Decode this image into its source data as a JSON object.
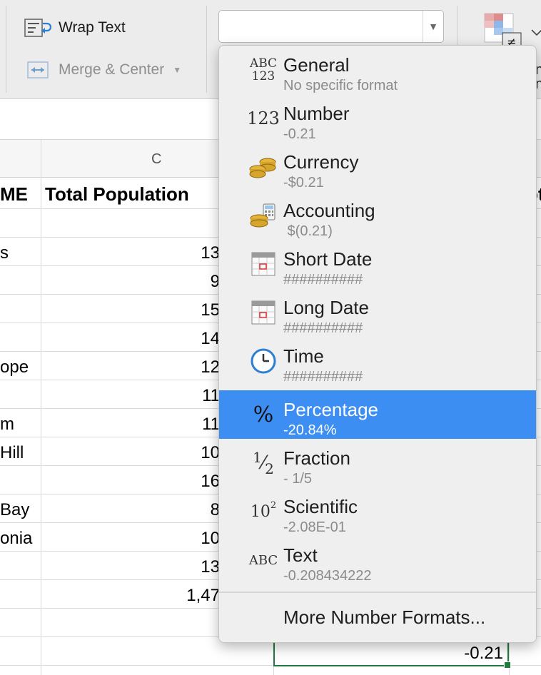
{
  "ribbon": {
    "wrap_text_label": "Wrap Text",
    "merge_center_label": "Merge & Center",
    "number_format_value": "",
    "cut_off_label": "na\nn"
  },
  "columns": {
    "c_label": "C"
  },
  "sheet": {
    "header_a": "ME",
    "header_c": "Total Population",
    "header_e": "ot",
    "rows": [
      {
        "a": "",
        "c": ""
      },
      {
        "a": "s",
        "c": "13"
      },
      {
        "a": "",
        "c": "9"
      },
      {
        "a": "",
        "c": "15"
      },
      {
        "a": "",
        "c": "14"
      },
      {
        "a": "ope",
        "c": "12"
      },
      {
        "a": "",
        "c": "11"
      },
      {
        "a": "m",
        "c": "11"
      },
      {
        "a": "Hill",
        "c": "10"
      },
      {
        "a": "",
        "c": "16"
      },
      {
        "a": "Bay",
        "c": "8"
      },
      {
        "a": "onia",
        "c": "10"
      },
      {
        "a": "",
        "c": "13"
      },
      {
        "a": "",
        "c": "1,47"
      },
      {
        "a": "",
        "c": ""
      },
      {
        "a": "",
        "c": ""
      }
    ],
    "selected_value": "-0.21"
  },
  "format_menu": {
    "items": [
      {
        "name": "General",
        "sample": "No specific format",
        "icon": "abc-123-icon"
      },
      {
        "name": "Number",
        "sample": "-0.21",
        "icon": "123-icon"
      },
      {
        "name": "Currency",
        "sample": "-$0.21",
        "icon": "coins-icon"
      },
      {
        "name": "Accounting",
        "sample": " $(0.21)",
        "icon": "accounting-icon"
      },
      {
        "name": "Short Date",
        "sample": "##########",
        "icon": "calendar-icon"
      },
      {
        "name": "Long Date",
        "sample": "##########",
        "icon": "calendar-icon"
      },
      {
        "name": "Time",
        "sample": "##########",
        "icon": "clock-icon"
      },
      {
        "name": "Percentage",
        "sample": "-20.84%",
        "icon": "percent-icon",
        "selected": true
      },
      {
        "name": "Fraction",
        "sample": "- 1/5",
        "icon": "fraction-icon"
      },
      {
        "name": "Scientific",
        "sample": "-2.08E-01",
        "icon": "scientific-icon"
      },
      {
        "name": "Text",
        "sample": "-0.208434222",
        "icon": "abc-icon"
      }
    ],
    "icon_glyphs": {
      "abc_top": "ABC",
      "abc_bottom": "123",
      "number": "123",
      "percent": "%",
      "fraction_num": "1",
      "fraction_den": "2",
      "sci_base": "10",
      "sci_exp": "2",
      "text": "ABC"
    },
    "more_label": "More Number Formats..."
  },
  "colors": {
    "highlight": "#3d8ef3",
    "selection_border": "#1f7a3d",
    "coin": "#d6a52c"
  }
}
